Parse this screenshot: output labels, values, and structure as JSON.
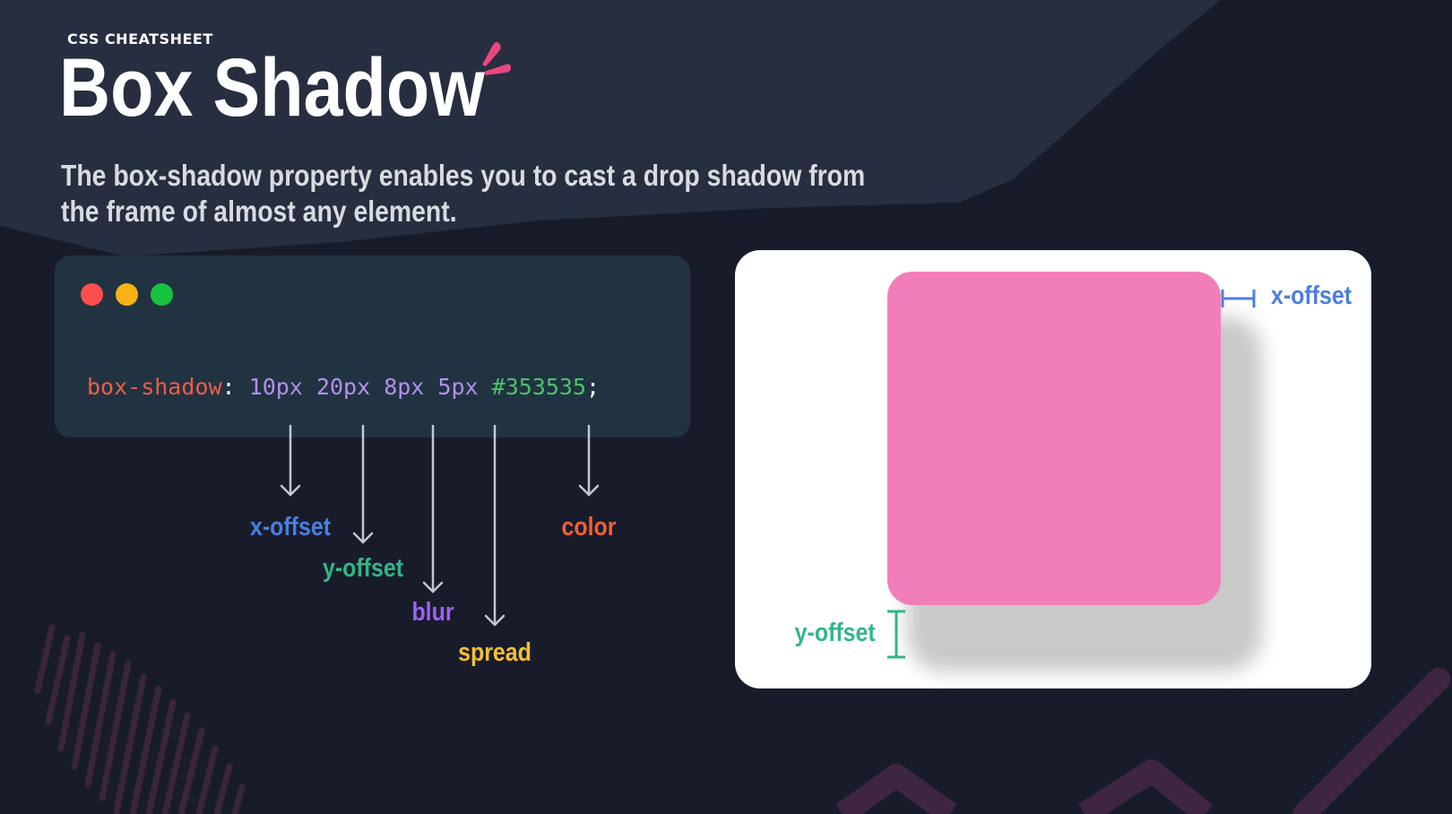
{
  "header": {
    "eyebrow": "CSS CHEATSHEET",
    "title": "Box Shadow",
    "description": "The box-shadow property enables you to cast a drop shadow from the frame of almost any element."
  },
  "code": {
    "property": "box-shadow",
    "colon": ":",
    "x_offset": "10px",
    "y_offset": "20px",
    "blur": "8px",
    "spread": "5px",
    "color": "#353535",
    "semicolon": ";"
  },
  "labels": {
    "x_offset": "x-offset",
    "y_offset": "y-offset",
    "blur": "blur",
    "spread": "spread",
    "color": "color"
  },
  "demo": {
    "x_offset_label": "x-offset",
    "y_offset_label": "y-offset"
  },
  "colors": {
    "background": "#181c2a",
    "code_bg": "#213341",
    "property": "#ef5d49",
    "number": "#b38ff0",
    "hex": "#4bc16a",
    "x_offset": "#4a7fe0",
    "y_offset": "#33b589",
    "blur": "#9a64f2",
    "spread": "#f3c032",
    "color": "#f25f33",
    "pink_box": "#f17eb8",
    "accent": "#ec4680"
  }
}
